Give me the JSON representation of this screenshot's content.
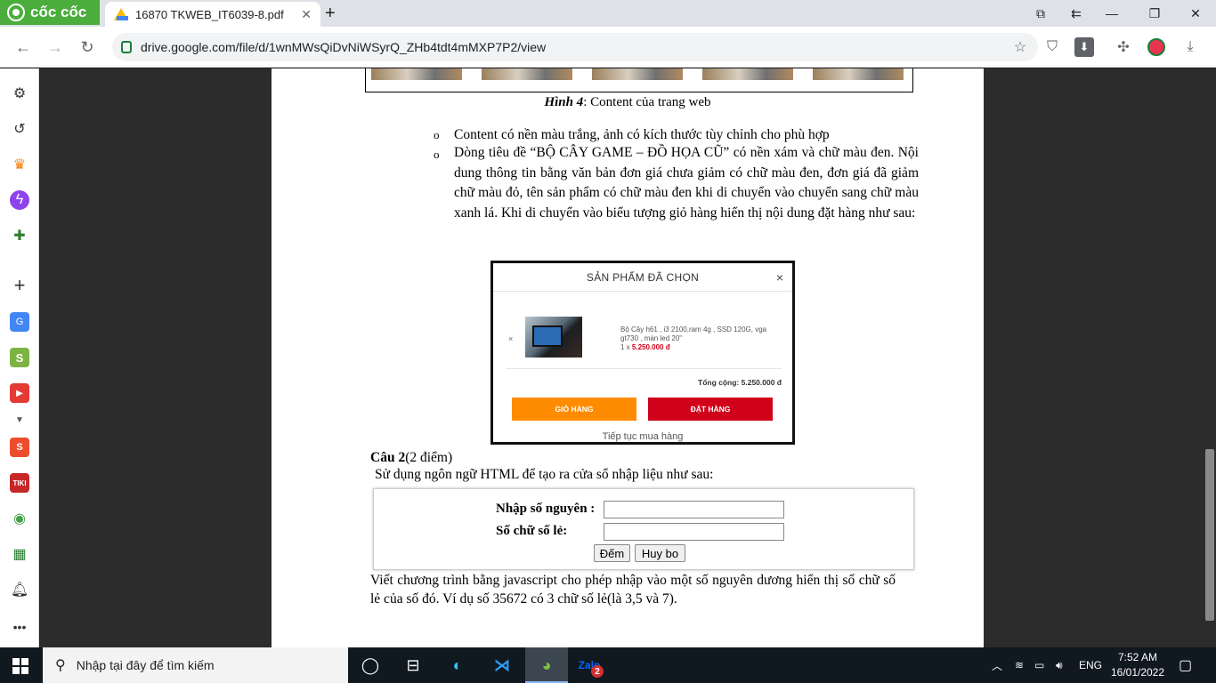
{
  "browser": {
    "brand": "cốc cốc",
    "tab_title": "16870 TKWEB_IT6039-8.pdf",
    "tab_close": "✕",
    "new_tab": "+",
    "url": "drive.google.com/file/d/1wnMWsQiDvNiWSyrQ_ZHb4tdt4mMXP7P2/view",
    "toolbar_icons": [
      "star-icon",
      "shield-icon",
      "download-box-icon",
      "puzzle-icon",
      "record-icon",
      "download-icon"
    ],
    "window_controls": [
      "minimize",
      "restore",
      "close"
    ]
  },
  "sidebar": {
    "items": [
      "gear-icon",
      "history-icon",
      "crown-icon",
      "messenger-icon",
      "gamepad-icon",
      "plus-icon",
      "translate-icon",
      "s-icon",
      "youtube-icon",
      "chevron-down-icon",
      "shopee-icon",
      "tiki-icon",
      "location-icon",
      "spreadsheet-icon",
      "bell-icon",
      "more-icon"
    ]
  },
  "document": {
    "caption_bold": "Hình 4",
    "caption_rest": ": Content của trang web",
    "bullet_char": "o",
    "bullet1": "Content có nền màu trắng, ảnh có kích thước tùy chỉnh cho phù hợp",
    "bullet2": "Dòng tiêu đề “BỘ CÂY GAME – ĐỒ HỌA CŨ” có nền xám và chữ màu đen. Nội dung thông tin bằng văn bản đơn giá chưa giảm có chữ màu đen, đơn giá đã giảm chữ màu đỏ, tên sản phẩm có chữ màu đen khi di chuyển vào chuyển sang chữ màu xanh lá. Khi di chuyển vào biểu tượng giỏ hàng hiển thị nội dung đặt hàng như sau:",
    "cart": {
      "title": "SẢN PHẨM ĐÃ CHỌN",
      "close": "×",
      "remove": "×",
      "product_name": "Bộ Cây h61 , i3 2100,ram 4g , SSD 120G, vga gt730 , màn led 20\"",
      "qty_prefix": "1 x ",
      "price": "5.250.000 đ",
      "total_label": "Tổng cộng: 5.250.000 đ",
      "btn_cart": "GIỎ HÀNG",
      "btn_order": "ĐẶT HÀNG",
      "continue": "Tiếp tục mua hàng",
      "colors": {
        "cart_btn": "#ff8c00",
        "order_btn": "#d0021b"
      }
    },
    "q2_title": "Câu 2",
    "q2_points": "(2 điểm)",
    "q2_task": "Sử dụng ngôn ngữ HTML để tạo ra cửa sổ nhập liệu như sau:",
    "form": {
      "label1": "Nhập số nguyên :",
      "label2": "Số chữ số lẻ:",
      "btn_count": "Đếm",
      "btn_cancel": "Huy bo"
    },
    "final_para": "Viết chương trình bằng javascript cho phép nhập vào một số nguyên dương hiển thị số chữ số lẻ của số đó. Ví dụ số 35672 có 3 chữ số lẻ(là 3,5 và 7)."
  },
  "taskbar": {
    "search_placeholder": "Nhập tại đây để tìm kiếm",
    "zalo_badge": "2",
    "lang": "ENG",
    "time": "7:52 AM",
    "date": "16/01/2022"
  }
}
